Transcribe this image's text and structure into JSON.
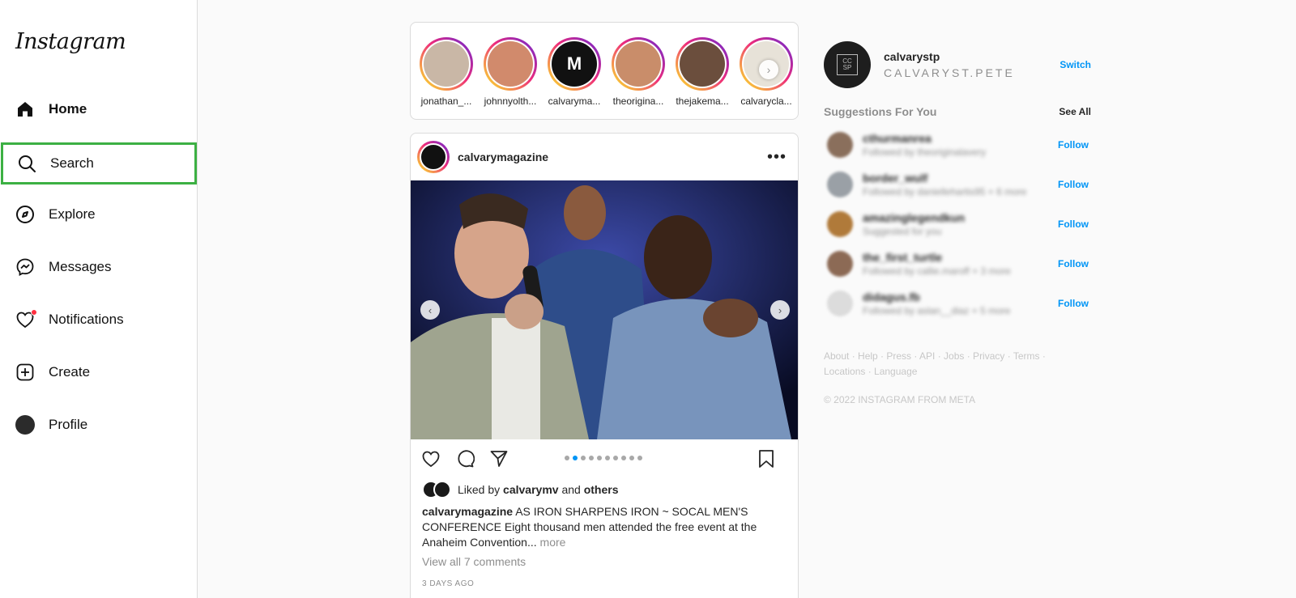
{
  "app": {
    "logo_text": "Instagram"
  },
  "sidebar": {
    "items": [
      {
        "label": "Home"
      },
      {
        "label": "Search"
      },
      {
        "label": "Explore"
      },
      {
        "label": "Messages"
      },
      {
        "label": "Notifications"
      },
      {
        "label": "Create"
      },
      {
        "label": "Profile"
      }
    ]
  },
  "stories": [
    {
      "name": "jonathan_...",
      "color": "#c9b7a6"
    },
    {
      "name": "johnnyolth...",
      "color": "#d18a6c"
    },
    {
      "name": "calvaryma...",
      "color": "#111111"
    },
    {
      "name": "theorigina...",
      "color": "#c98d6a"
    },
    {
      "name": "thejakema...",
      "color": "#6b4e3d"
    },
    {
      "name": "calvarycla...",
      "color": "#e7e2d8"
    }
  ],
  "post": {
    "username": "calvarymagazine",
    "carousel_count": 10,
    "carousel_active": 2,
    "liked_by_prefix": "Liked by",
    "liked_by_user": "calvarymv",
    "liked_by_and": "and",
    "liked_by_others": "others",
    "caption_user": "calvarymagazine",
    "caption_text": "AS IRON SHARPENS IRON ~ SOCAL MEN'S CONFERENCE Eight thousand men attended the free event at the Anaheim Convention...",
    "caption_more": "more",
    "comments_link": "View all 7 comments",
    "timestamp": "3 DAYS AGO"
  },
  "right": {
    "username": "calvarystp",
    "full_name": "CALVARYST.PETE",
    "switch_label": "Switch",
    "suggestions_title": "Suggestions For You",
    "see_all_label": "See All",
    "suggestions": [
      {
        "name": "cthurmanrea",
        "sub": "Followed by theoriginalavery",
        "follow": "Follow",
        "color": "#8a6f5c"
      },
      {
        "name": "border_wulf",
        "sub": "Followed by daniellehartis95 + 6 more",
        "follow": "Follow",
        "color": "#9aa0a6"
      },
      {
        "name": "amazinglegendkun",
        "sub": "Suggested for you",
        "follow": "Follow",
        "color": "#b07a3a"
      },
      {
        "name": "the_first_turtle",
        "sub": "Followed by callie.maroff + 3 more",
        "follow": "Follow",
        "color": "#8c6a55"
      },
      {
        "name": "didagus.fb",
        "sub": "Followed by aslan__diaz + 5 more",
        "follow": "Follow",
        "color": "#dcdcdc"
      }
    ],
    "footer_links": "About · Help · Press · API · Jobs · Privacy · Terms · Locations · Language",
    "copyright": "© 2022 INSTAGRAM FROM META"
  }
}
